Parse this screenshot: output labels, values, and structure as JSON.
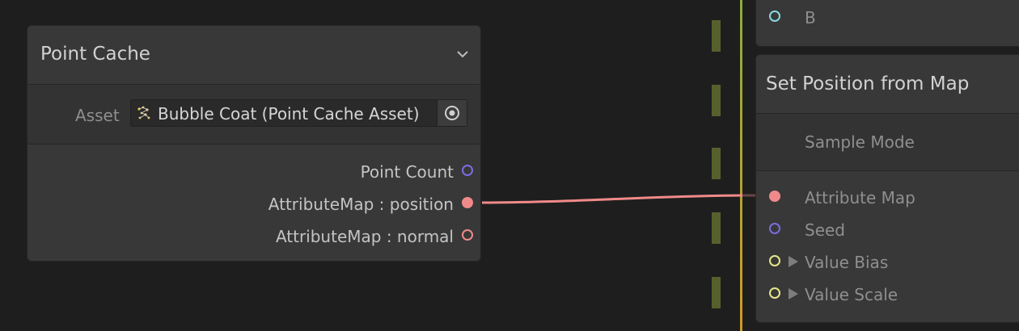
{
  "colors": {
    "port_count": "#7b6ce0",
    "port_attribute": "#f08a8a",
    "port_seed": "#7b6ce0",
    "port_float": "#e6e68a",
    "port_b": "#8ad8e0",
    "edge": "#f08a8a"
  },
  "point_cache": {
    "title": "Point Cache",
    "asset_label": "Asset",
    "asset_value": "Bubble Coat (Point Cache Asset)",
    "asset_icon": "point-cache-asset-icon",
    "outputs": [
      "Point Count",
      "AttributeMap : position",
      "AttributeMap : normal"
    ]
  },
  "right_node_top": {
    "port_label": "B"
  },
  "set_position": {
    "title": "Set Position from Map",
    "sample_mode_label": "Sample Mode",
    "inputs": {
      "attribute_map": "Attribute Map",
      "seed": "Seed",
      "value_bias": "Value Bias",
      "value_scale": "Value Scale"
    }
  }
}
